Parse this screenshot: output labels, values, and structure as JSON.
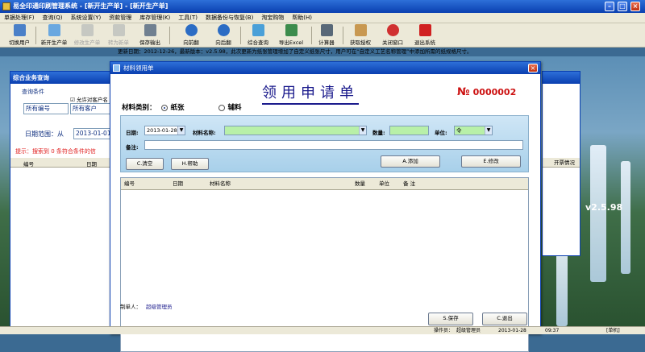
{
  "window": {
    "title": "易全印通印刷管理系统 - [新开生产单] - [新开生产单]"
  },
  "menu": [
    "单据处理(F)",
    "查询(Q)",
    "系统设置(Y)",
    "资款管理",
    "库存管理(K)",
    "工具(T)",
    "数据备份与恢复(B)",
    "淘宝购物",
    "帮助(H)"
  ],
  "toolbar": [
    {
      "label": "切换用户",
      "icon": "user-switch-icon",
      "enabled": true
    },
    {
      "label": "新开生产单",
      "icon": "new-order-icon",
      "enabled": true
    },
    {
      "label": "修改生产单",
      "icon": "edit-order-icon",
      "enabled": false
    },
    {
      "label": "转为新单",
      "icon": "convert-order-icon",
      "enabled": false
    },
    {
      "label": "保存输出",
      "icon": "printer-icon",
      "enabled": true
    },
    {
      "label": "向前翻",
      "icon": "back-arrow-icon",
      "enabled": true
    },
    {
      "label": "向后翻",
      "icon": "forward-arrow-icon",
      "enabled": true
    },
    {
      "label": "综合查询",
      "icon": "query-icon",
      "enabled": true
    },
    {
      "label": "导出Excel",
      "icon": "excel-icon",
      "enabled": true
    },
    {
      "label": "计算器",
      "icon": "calculator-icon",
      "enabled": true
    },
    {
      "label": "获取授权",
      "icon": "authorize-icon",
      "enabled": true
    },
    {
      "label": "关闭窗口",
      "icon": "close-window-icon",
      "enabled": true
    },
    {
      "label": "退出系统",
      "icon": "exit-icon",
      "enabled": true
    }
  ],
  "news": "更新日期：2012-12-26，最新版本：v2.5.98，此次更新为纸张管理增加了自定义纸张尺寸，用户可在“自定义工艺名称管理”中添加所需的纸规格尺寸。",
  "back_window": {
    "title": "综合业务查询",
    "query_section": "查询条件",
    "option_check": "允许对客户名",
    "filter1": "所有编号",
    "filter2": "所有客户",
    "date_label": "日期范围：从",
    "date_from": "2013-01-01",
    "hint": "提示：搜索到 0 条符合条件的信",
    "col_no": "编号",
    "col_date": "日期",
    "col_delivery": "开票情况"
  },
  "dialog": {
    "title": "材料领用单",
    "heading": "领用申请单",
    "doc_symbol": "№",
    "doc_no": "0000002",
    "category_label": "材料类别：",
    "category_paper": "纸张",
    "category_aux": "辅料",
    "date_label": "日期:",
    "date_value": "2013-01-28",
    "material_label": "材料名称:",
    "qty_label": "数量:",
    "unit_label": "单位:",
    "unit_value": "令",
    "note_label": "备注:",
    "clear_btn": "C.清空",
    "help_btn": "H.帮助",
    "add_btn": "A.添加",
    "edit_btn": "E.修改",
    "columns": [
      "编号",
      "日期",
      "材料名称",
      "数量",
      "单位",
      "备 注"
    ],
    "maker_label": "制单人：",
    "maker": "超级管理员",
    "save_btn": "S.保存",
    "exit_btn": "C.退出"
  },
  "version_badge": "v2.5.98",
  "status": {
    "operator_label": "操作员：",
    "operator": "超级管理员",
    "date": "2013-01-28",
    "time": "09:37",
    "mode": "[单机]"
  }
}
